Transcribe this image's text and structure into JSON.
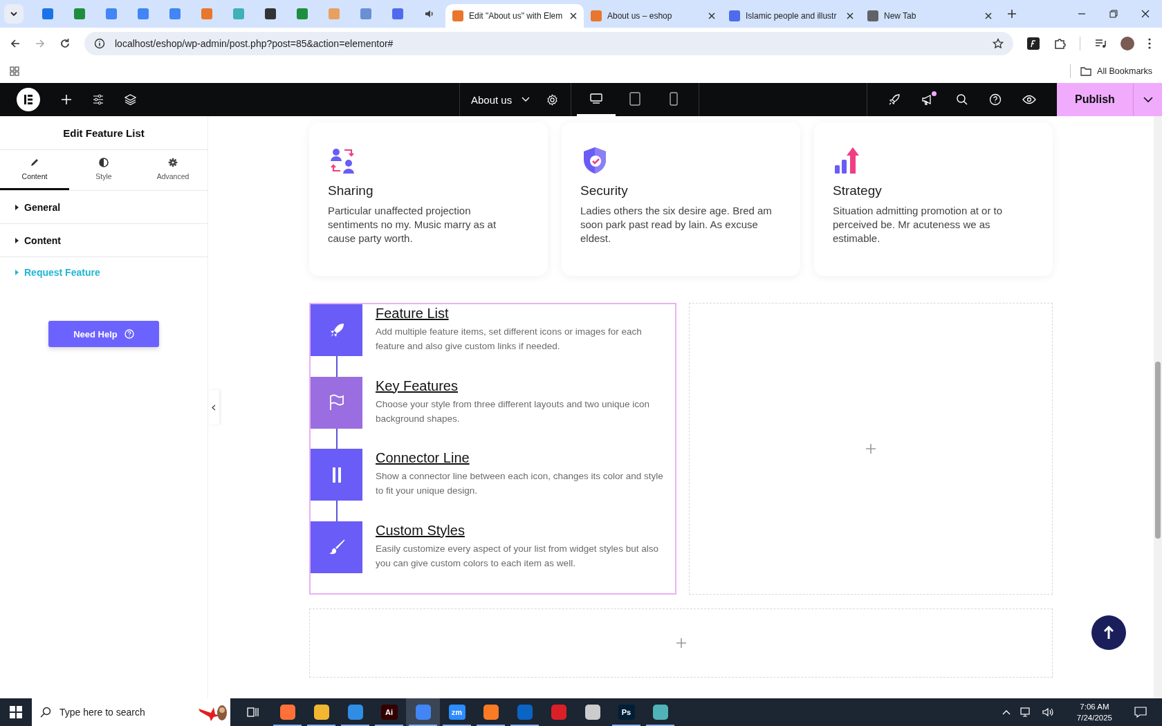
{
  "browser": {
    "tabs": [
      {
        "label": "Edit \"About us\" with Elem",
        "selected": true,
        "color": "#e8762d"
      },
      {
        "label": "About us – eshop",
        "selected": false,
        "color": "#e8762d"
      },
      {
        "label": "Islamic people and illustr",
        "selected": false,
        "color": "#4f6bed"
      },
      {
        "label": "New Tab",
        "selected": false,
        "color": "#5f6368"
      }
    ],
    "address": "localhost/eshop/wp-admin/post.php?post=85&action=elementor#",
    "bookmarks_label": "All Bookmarks"
  },
  "editor": {
    "page_title": "About us",
    "publish": "Publish",
    "devices": [
      {
        "kind": "desktop",
        "selected": true
      },
      {
        "kind": "tablet",
        "selected": false
      },
      {
        "kind": "mobile",
        "selected": false
      }
    ],
    "notification": true
  },
  "panel": {
    "title": "Edit Feature List",
    "tabs": [
      {
        "label": "Content",
        "selected": true
      },
      {
        "label": "Style",
        "selected": false
      },
      {
        "label": "Advanced",
        "selected": false
      }
    ],
    "sections": [
      {
        "label": "General",
        "kind": "section"
      },
      {
        "label": "Content",
        "kind": "section"
      },
      {
        "label": "Request Feature",
        "kind": "promo"
      }
    ],
    "help_button": "Need Help"
  },
  "cards": [
    {
      "title": "Sharing",
      "text": "Particular unaffected projection sentiments no my. Music marry as at cause party worth."
    },
    {
      "title": "Security",
      "text": "Ladies others the six desire age. Bred am soon park past read by lain. As excuse eldest."
    },
    {
      "title": "Strategy",
      "text": "Situation admitting promotion at or to perceived be. Mr acuteness we as estimable."
    }
  ],
  "feature_list": [
    {
      "title": "Feature List",
      "text": "Add multiple feature items, set different icons or images for each feature and also give custom links if needed.",
      "color": "#6a5cf6"
    },
    {
      "title": "Key Features",
      "text": "Choose your style from three different layouts and two unique icon background shapes.",
      "color": "#9a6ee0"
    },
    {
      "title": "Connector Line",
      "text": "Show a connector line between each icon, changes its color and style to fit your unique design.",
      "color": "#6a5cf6"
    },
    {
      "title": "Custom Styles",
      "text": "Easily customize every aspect of your list from widget styles but also you can give custom colors to each item as well.",
      "color": "#6a5cf6"
    }
  ],
  "taskbar": {
    "search_placeholder": "Type here to search",
    "apps": [
      {
        "color": "#ff7139",
        "selected": false,
        "running": true
      },
      {
        "color": "#f2b632",
        "selected": false,
        "running": true
      },
      {
        "color": "#2f8de4",
        "selected": false,
        "running": true
      },
      {
        "label": "Ai",
        "color": "#330000",
        "selected": false,
        "running": true
      },
      {
        "color": "#4285f4",
        "selected": true,
        "running": true
      },
      {
        "label": "zm",
        "color": "#2d8cff",
        "selected": false,
        "running": true
      },
      {
        "color": "#fb7a24",
        "selected": false,
        "running": true
      },
      {
        "color": "#0a64c4",
        "selected": false,
        "running": true
      },
      {
        "color": "#da1f26",
        "selected": false,
        "running": false
      },
      {
        "color": "#cccccc",
        "selected": false,
        "running": false
      },
      {
        "label": "Ps",
        "color": "#001e36",
        "selected": false,
        "running": true
      },
      {
        "color": "#4fb3b8",
        "selected": false,
        "running": true
      }
    ],
    "time": "7:06 AM",
    "date": "7/24/2025"
  }
}
